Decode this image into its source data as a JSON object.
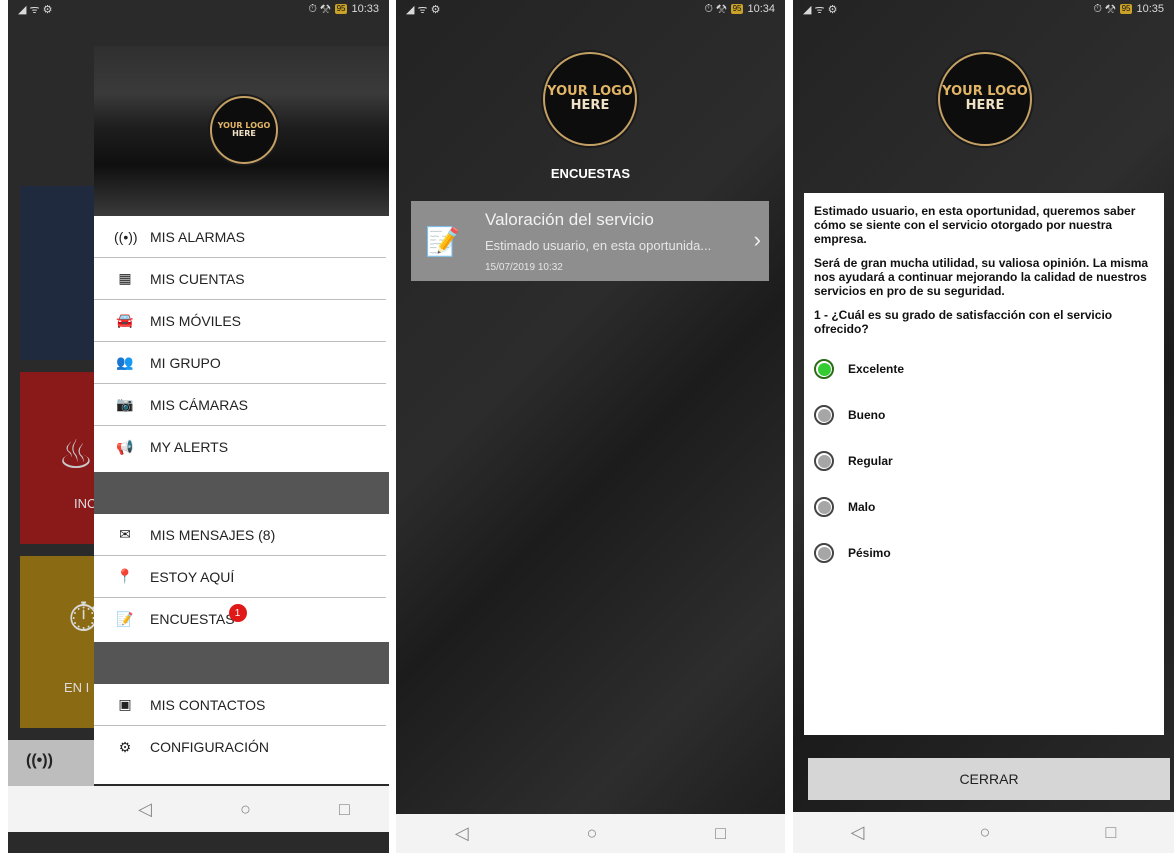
{
  "phone1": {
    "status": {
      "signal": "◢ ᯤ ⚙",
      "icons": "⏱ ⚒",
      "battery": "95",
      "time": "10:33"
    },
    "logo": {
      "line1": "YOUR LOGO",
      "line2": "HERE"
    },
    "dash_tiles": [
      "INC",
      "EN I"
    ],
    "dash_bottom_icon": "((•))",
    "menu": [
      {
        "icon": "((•))",
        "label": "MIS ALARMAS"
      },
      {
        "icon": "▦",
        "label": "MIS CUENTAS"
      },
      {
        "icon": "🚘",
        "label": "MIS MÓVILES"
      },
      {
        "icon": "👥",
        "label": "MI GRUPO"
      },
      {
        "icon": "📷",
        "label": "MIS CÁMARAS"
      },
      {
        "icon": "📢",
        "label": "MY ALERTS"
      },
      {
        "icon": "✉",
        "label": "MIS MENSAJES (8)"
      },
      {
        "icon": "📍",
        "label": "ESTOY AQUÍ"
      },
      {
        "icon": "📝",
        "label": "ENCUESTAS",
        "badge": "1"
      },
      {
        "icon": "▣",
        "label": "MIS CONTACTOS"
      },
      {
        "icon": "⚙",
        "label": "CONFIGURACIÓN"
      }
    ]
  },
  "phone2": {
    "status": {
      "signal": "◢ ᯤ ⚙",
      "icons": "⏱ ⚒",
      "battery": "95",
      "time": "10:34"
    },
    "logo": {
      "line1": "YOUR LOGO",
      "line2": "HERE"
    },
    "title": "ENCUESTAS",
    "survey": {
      "title": "Valoración del servicio",
      "preview": "Estimado usuario, en esta oportunida...",
      "date": "15/07/2019 10:32"
    }
  },
  "phone3": {
    "status": {
      "signal": "◢ ᯤ ⚙",
      "icons": "⏱ ⚒",
      "battery": "95",
      "time": "10:35"
    },
    "logo": {
      "line1": "YOUR LOGO",
      "line2": "HERE"
    },
    "intro1": "Estimado usuario, en esta oportunidad, queremos saber cómo se siente con el servicio otorgado por nuestra empresa.",
    "intro2": "Será de gran mucha utilidad, su valiosa opinión. La misma nos ayudará a continuar mejorando la calidad de nuestros servicios en pro de su seguridad.",
    "question": "1 - ¿Cuál es su grado de satisfacción con el servicio ofrecido?",
    "options": [
      {
        "label": "Excelente",
        "selected": true
      },
      {
        "label": "Bueno",
        "selected": false
      },
      {
        "label": "Regular",
        "selected": false
      },
      {
        "label": "Malo",
        "selected": false
      },
      {
        "label": "Pésimo",
        "selected": false
      }
    ],
    "close_label": "CERRAR"
  },
  "nav": {
    "back": "◁",
    "home": "○",
    "recent": "□"
  },
  "colors": {
    "accent_green": "#33cc33",
    "badge_red": "#e01818",
    "logo_gold": "#e2b566"
  }
}
